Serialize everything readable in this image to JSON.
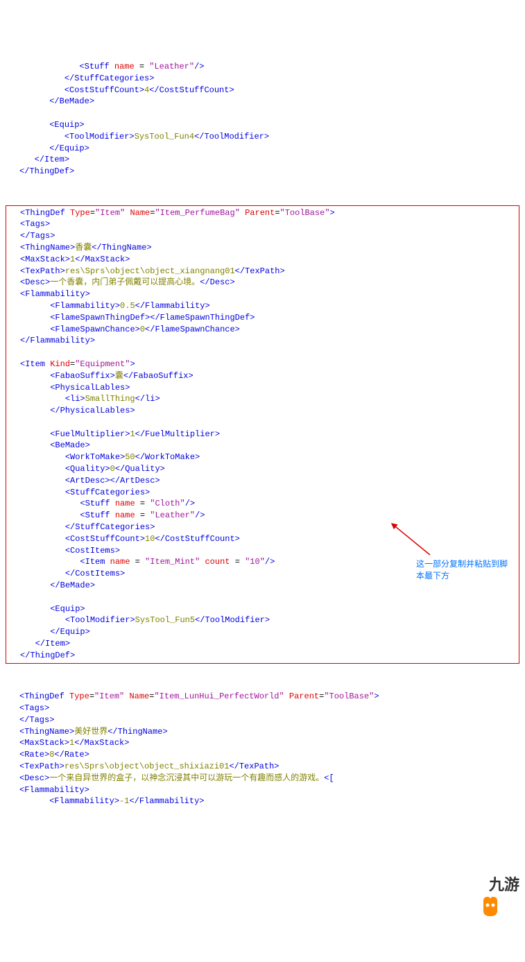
{
  "top": {
    "l1": "            <Stuff name = \"Leather\"/>",
    "l2": "         </StuffCategories>",
    "l3": "         <CostStuffCount>4</CostStuffCount>",
    "l4": "      </BeMade>",
    "l5": "",
    "l6": "      <Equip>",
    "l7": "         <ToolModifier>SysTool_Fun4</ToolModifier>",
    "l8": "      </Equip>",
    "l9": "   </Item>",
    "l10": "</ThingDef>"
  },
  "mid": {
    "l1": "<ThingDef Type=\"Item\" Name=\"Item_PerfumeBag\" Parent=\"ToolBase\">",
    "l2": "<Tags>",
    "l3": "</Tags>",
    "l4": "<ThingName>香囊</ThingName>",
    "l5": "<MaxStack>1</MaxStack>",
    "l6": "<TexPath>res\\Sprs\\object\\object_xiangnang01</TexPath>",
    "l7": "<Desc>一个香囊，内门弟子佩戴可以提高心境。</Desc>",
    "l8": "<Flammability>",
    "l9": "      <Flammability>0.5</Flammability>",
    "l10": "      <FlameSpawnThingDef></FlameSpawnThingDef>",
    "l11": "      <FlameSpawnChance>0</FlameSpawnChance>",
    "l12": "</Flammability>",
    "l13": "",
    "l14": "<Item Kind=\"Equipment\">",
    "l15": "      <FabaoSuffix>囊</FabaoSuffix>",
    "l16": "      <PhysicalLables>",
    "l17": "         <li>SmallThing</li>",
    "l18": "      </PhysicalLables>",
    "l19": "",
    "l20": "      <FuelMultiplier>1</FuelMultiplier>",
    "l21": "      <BeMade>",
    "l22": "         <WorkToMake>50</WorkToMake>",
    "l23": "         <Quality>0</Quality>",
    "l24": "         <ArtDesc></ArtDesc>",
    "l25": "         <StuffCategories>",
    "l26": "            <Stuff name = \"Cloth\"/>",
    "l27": "            <Stuff name = \"Leather\"/>",
    "l28": "         </StuffCategories>",
    "l29": "         <CostStuffCount>10</CostStuffCount>",
    "l30": "         <CostItems>",
    "l31": "            <Item name = \"Item_Mint\" count = \"10\"/>",
    "l32": "         </CostItems>",
    "l33": "      </BeMade>",
    "l34": "",
    "l35": "      <Equip>",
    "l36": "         <ToolModifier>SysTool_Fun5</ToolModifier>",
    "l37": "      </Equip>",
    "l38": "   </Item>",
    "l39": "</ThingDef>"
  },
  "bot": {
    "l1": "<ThingDef Type=\"Item\" Name=\"Item_LunHui_PerfectWorld\" Parent=\"ToolBase\">",
    "l2": "<Tags>",
    "l3": "</Tags>",
    "l4": "<ThingName>美好世界</ThingName>",
    "l5": "<MaxStack>1</MaxStack>",
    "l6": "<Rate>8</Rate>",
    "l7": "<TexPath>res\\Sprs\\object\\object_shixiazi01</TexPath>",
    "l8": "<Desc>一个来自异世界的盒子，以神念沉浸其中可以游玩一个有趣而感人的游戏。<[",
    "l9": "<Flammability>",
    "l10": "      <Flammability>-1</Flammability>"
  },
  "note": "这一部分复制并粘贴到脚本最下方",
  "logo_text": "九游"
}
